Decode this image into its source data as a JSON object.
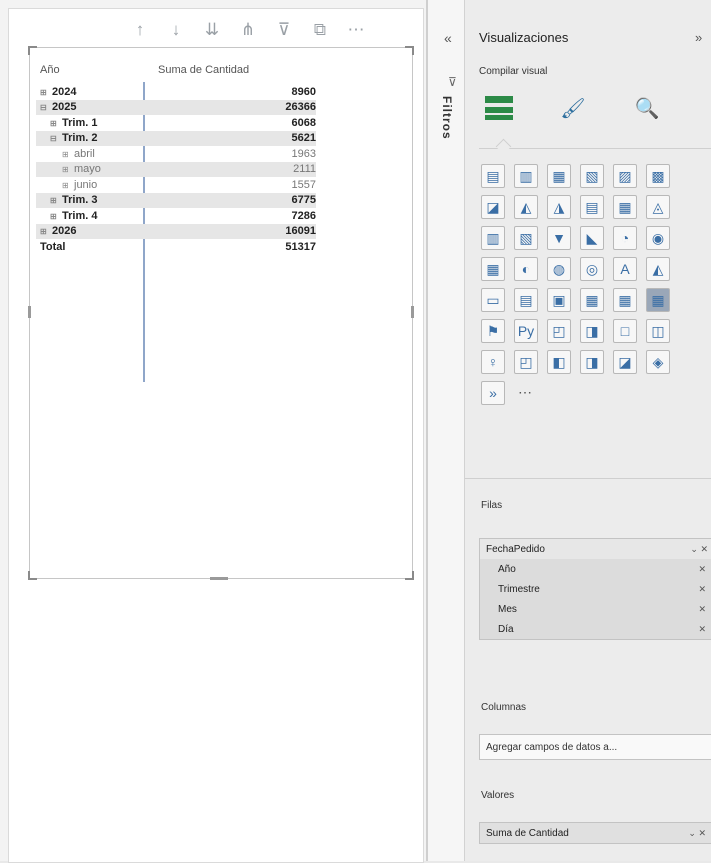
{
  "visual_header": {
    "icons": [
      "arrow-up-icon",
      "arrow-down-icon",
      "double-arrow-down-icon",
      "expand-hierarchy-icon",
      "filter-icon",
      "focus-mode-icon",
      "more-options-icon"
    ],
    "glyphs": [
      "↑",
      "↓",
      "⇊",
      "⋔",
      "⊽",
      "⧉",
      "⋯"
    ]
  },
  "matrix": {
    "headers": {
      "col1": "Año",
      "col2": "Suma de Cantidad"
    },
    "rows": [
      {
        "label": "2024",
        "value": "8960",
        "level": 0,
        "expander": "⊞",
        "shaded": false,
        "bold": true
      },
      {
        "label": "2025",
        "value": "26366",
        "level": 0,
        "expander": "⊟",
        "shaded": true,
        "bold": true
      },
      {
        "label": "Trim. 1",
        "value": "6068",
        "level": 1,
        "expander": "⊞",
        "shaded": false,
        "bold": true
      },
      {
        "label": "Trim. 2",
        "value": "5621",
        "level": 1,
        "expander": "⊟",
        "shaded": true,
        "bold": true
      },
      {
        "label": "abril",
        "value": "1963",
        "level": 2,
        "expander": "⊞",
        "shaded": false,
        "bold": false
      },
      {
        "label": "mayo",
        "value": "2111",
        "level": 2,
        "expander": "⊞",
        "shaded": true,
        "bold": false
      },
      {
        "label": "junio",
        "value": "1557",
        "level": 2,
        "expander": "⊞",
        "shaded": false,
        "bold": false
      },
      {
        "label": "Trim. 3",
        "value": "6775",
        "level": 1,
        "expander": "⊞",
        "shaded": true,
        "bold": true
      },
      {
        "label": "Trim. 4",
        "value": "7286",
        "level": 1,
        "expander": "⊞",
        "shaded": false,
        "bold": true
      },
      {
        "label": "2026",
        "value": "16091",
        "level": 0,
        "expander": "⊞",
        "shaded": true,
        "bold": true
      },
      {
        "label": "Total",
        "value": "51317",
        "level": 0,
        "expander": "",
        "shaded": false,
        "bold": true
      }
    ]
  },
  "filters_pane": {
    "label": "Filtros",
    "collapse_glyph": "«",
    "funnel_glyph": "⊽"
  },
  "visualizations": {
    "title": "Visualizaciones",
    "expand_glyph": "»",
    "subtitle": "Compilar visual",
    "tabs": {
      "format_glyph": "🖌",
      "analytics_glyph": "🔍"
    },
    "icon_glyphs": [
      "▤",
      "▥",
      "▦",
      "▧",
      "▨",
      "▩",
      "◪",
      "◭",
      "◮",
      "▤",
      "▦",
      "◬",
      "▥",
      "▧",
      "▼",
      "◣",
      "◔",
      "◉",
      "▦",
      "◐",
      "◍",
      "◎",
      "A",
      "◭",
      "▭",
      "▤",
      "▣",
      "▦",
      "▦",
      "▦",
      "⚑",
      "Py",
      "◰",
      "◨",
      "□",
      "◫",
      "♀",
      "◰",
      "◧",
      "◨",
      "◪",
      "◈",
      "»",
      "⋯"
    ],
    "selected_icon_index": 29,
    "rows_well": {
      "label": "Filas",
      "field": "FechaPedido",
      "field_controls": "⌄ ✕",
      "sub_fields": [
        "Año",
        "Trimestre",
        "Mes",
        "Día"
      ],
      "remove_glyph": "✕"
    },
    "columns_well": {
      "label": "Columnas",
      "placeholder": "Agregar campos de datos a..."
    },
    "values_well": {
      "label": "Valores",
      "field": "Suma de Cantidad",
      "field_controls": "⌄ ✕"
    }
  }
}
